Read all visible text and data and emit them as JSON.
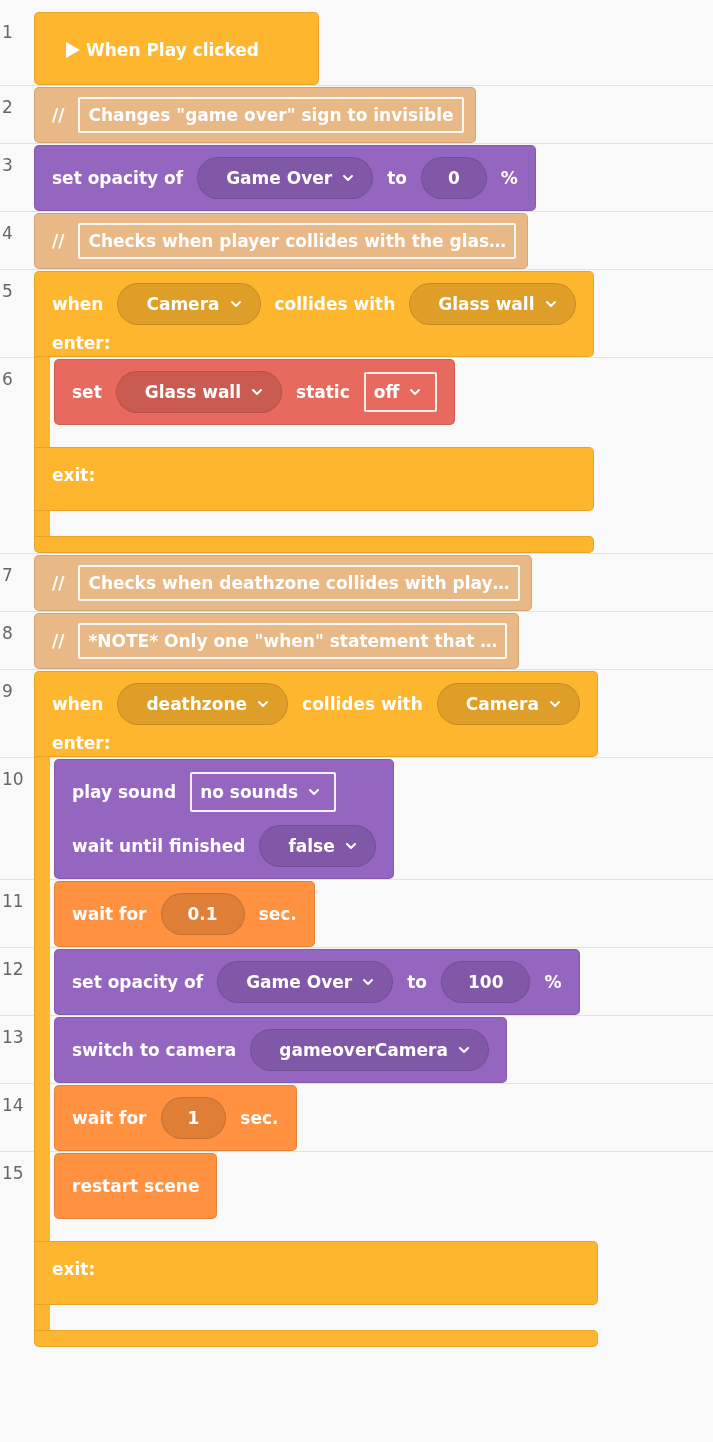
{
  "blocks": [
    {
      "line": "1",
      "kind": "hat",
      "color": "#ffb62f",
      "text": "When Play clicked"
    },
    {
      "line": "2",
      "kind": "comment",
      "color": "#e8b886",
      "marker": "//",
      "text": "Changes \"game over\" sign to invisible"
    },
    {
      "line": "3",
      "kind": "statement",
      "color": "#9466c0",
      "lines": [
        [
          {
            "kind": "label",
            "text": "set opacity of"
          },
          {
            "kind": "dropdown",
            "text": "Game Over"
          },
          {
            "kind": "label",
            "text": "to"
          },
          {
            "kind": "number",
            "text": "0"
          },
          {
            "kind": "label",
            "text": "%"
          }
        ]
      ]
    },
    {
      "line": "4",
      "kind": "comment",
      "color": "#e8b886",
      "marker": "//",
      "text": "Checks when player collides with the glas…"
    },
    {
      "line": "5",
      "kind": "collision",
      "color": "#ffb62f",
      "lines": [
        [
          {
            "kind": "label",
            "text": "when"
          },
          {
            "kind": "dropdown",
            "text": "Camera"
          },
          {
            "kind": "label",
            "text": "collides with"
          },
          {
            "kind": "dropdown",
            "text": "Glass wall"
          }
        ]
      ],
      "enter_label": "enter:",
      "children": [
        {
          "line": "6",
          "kind": "statement",
          "color": "#e8695d",
          "lines": [
            [
              {
                "kind": "label",
                "text": "set"
              },
              {
                "kind": "dropdown",
                "text": "Glass wall"
              },
              {
                "kind": "label",
                "text": "static"
              },
              {
                "kind": "select",
                "text": "off"
              }
            ]
          ]
        }
      ],
      "exit_label": "exit:"
    },
    {
      "line": "7",
      "kind": "comment",
      "color": "#e8b886",
      "marker": "//",
      "text": "Checks when deathzone collides with play…"
    },
    {
      "line": "8",
      "kind": "comment",
      "color": "#e8b886",
      "marker": "//",
      "text": "*NOTE* Only one \"when\" statement that …"
    },
    {
      "line": "9",
      "kind": "collision",
      "color": "#ffb62f",
      "lines": [
        [
          {
            "kind": "label",
            "text": "when"
          },
          {
            "kind": "dropdown",
            "text": "deathzone"
          },
          {
            "kind": "label",
            "text": "collides with"
          },
          {
            "kind": "dropdown",
            "text": "Camera"
          }
        ]
      ],
      "enter_label": "enter:",
      "children": [
        {
          "line": "10",
          "kind": "statement",
          "color": "#9466c0",
          "lines": [
            [
              {
                "kind": "label",
                "text": "play sound"
              },
              {
                "kind": "select",
                "text": "no sounds"
              }
            ],
            [
              {
                "kind": "label",
                "text": "wait until finished"
              },
              {
                "kind": "dropdown",
                "text": "false"
              }
            ]
          ]
        },
        {
          "line": "11",
          "kind": "statement",
          "color": "#ff9140",
          "lines": [
            [
              {
                "kind": "label",
                "text": "wait for"
              },
              {
                "kind": "number",
                "text": "0.1"
              },
              {
                "kind": "label",
                "text": "sec."
              }
            ]
          ]
        },
        {
          "line": "12",
          "kind": "statement",
          "color": "#9466c0",
          "lines": [
            [
              {
                "kind": "label",
                "text": "set opacity of"
              },
              {
                "kind": "dropdown",
                "text": "Game Over"
              },
              {
                "kind": "label",
                "text": "to"
              },
              {
                "kind": "number",
                "text": "100"
              },
              {
                "kind": "label",
                "text": "%"
              }
            ]
          ]
        },
        {
          "line": "13",
          "kind": "statement",
          "color": "#9466c0",
          "lines": [
            [
              {
                "kind": "label",
                "text": "switch to camera"
              },
              {
                "kind": "dropdown",
                "text": "gameoverCamera"
              }
            ]
          ]
        },
        {
          "line": "14",
          "kind": "statement",
          "color": "#ff9140",
          "lines": [
            [
              {
                "kind": "label",
                "text": "wait for"
              },
              {
                "kind": "number",
                "text": "1"
              },
              {
                "kind": "label",
                "text": "sec."
              }
            ]
          ]
        },
        {
          "line": "15",
          "kind": "statement",
          "color": "#ff9140",
          "lines": [
            [
              {
                "kind": "label",
                "text": "restart scene"
              }
            ]
          ]
        }
      ],
      "exit_label": "exit:"
    }
  ]
}
